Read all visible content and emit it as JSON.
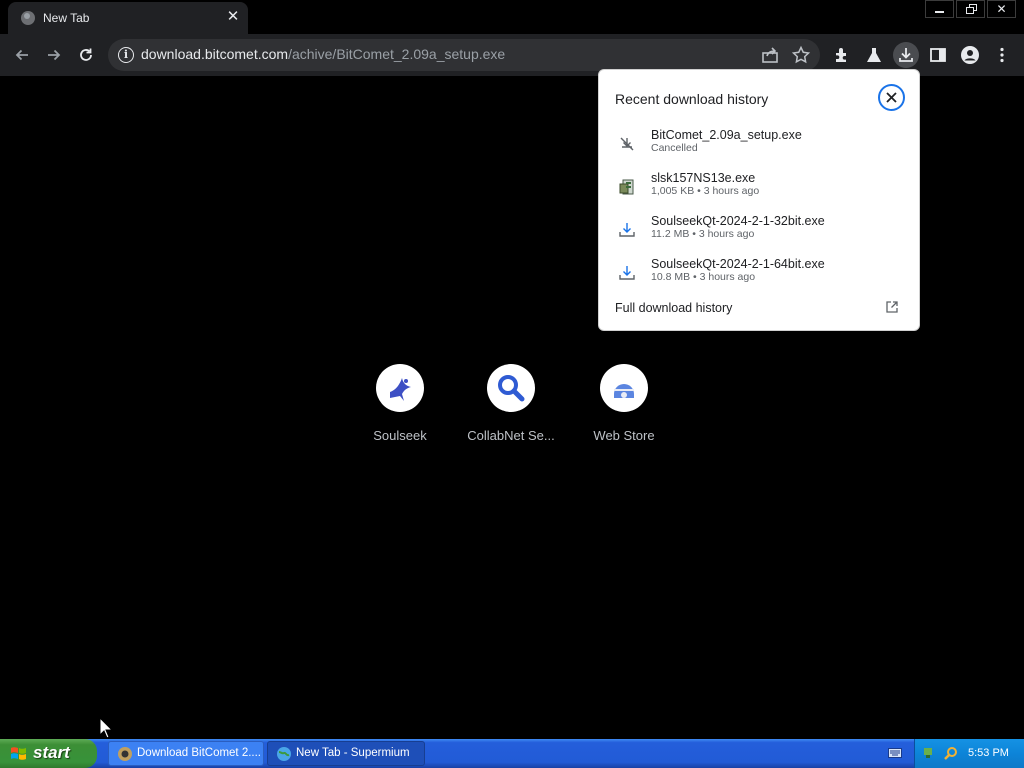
{
  "browser": {
    "tab": {
      "title": "New Tab"
    },
    "address_bar": {
      "host": "download.bitcomet.com",
      "path": "/achive/BitComet_2.09a_setup.exe"
    }
  },
  "shortcuts": [
    {
      "label": "Soulseek"
    },
    {
      "label": "CollabNet Se..."
    },
    {
      "label": "Web Store"
    }
  ],
  "download_bubble": {
    "title": "Recent download history",
    "items": [
      {
        "name": "BitComet_2.09a_setup.exe",
        "meta": "Cancelled",
        "icon": "cancelled-download-icon"
      },
      {
        "name": "slsk157NS13e.exe",
        "meta": "1,005 KB • 3 hours ago",
        "icon": "installer-file-icon"
      },
      {
        "name": "SoulseekQt-2024-2-1-32bit.exe",
        "meta": "11.2 MB • 3 hours ago",
        "icon": "download-file-icon"
      },
      {
        "name": "SoulseekQt-2024-2-1-64bit.exe",
        "meta": "10.8 MB • 3 hours ago",
        "icon": "download-file-icon"
      }
    ],
    "full_history_label": "Full download history"
  },
  "taskbar": {
    "start_label": "start",
    "tasks": [
      {
        "label": "Download BitComet 2...."
      },
      {
        "label": "New Tab - Supermium"
      }
    ],
    "clock": "5:53 PM"
  },
  "colors": {
    "accent": "#1a73e8",
    "toolbar": "#202124",
    "omnibox": "#303134",
    "taskbar_blue": "#245edb",
    "start_green": "#3c8f36"
  }
}
